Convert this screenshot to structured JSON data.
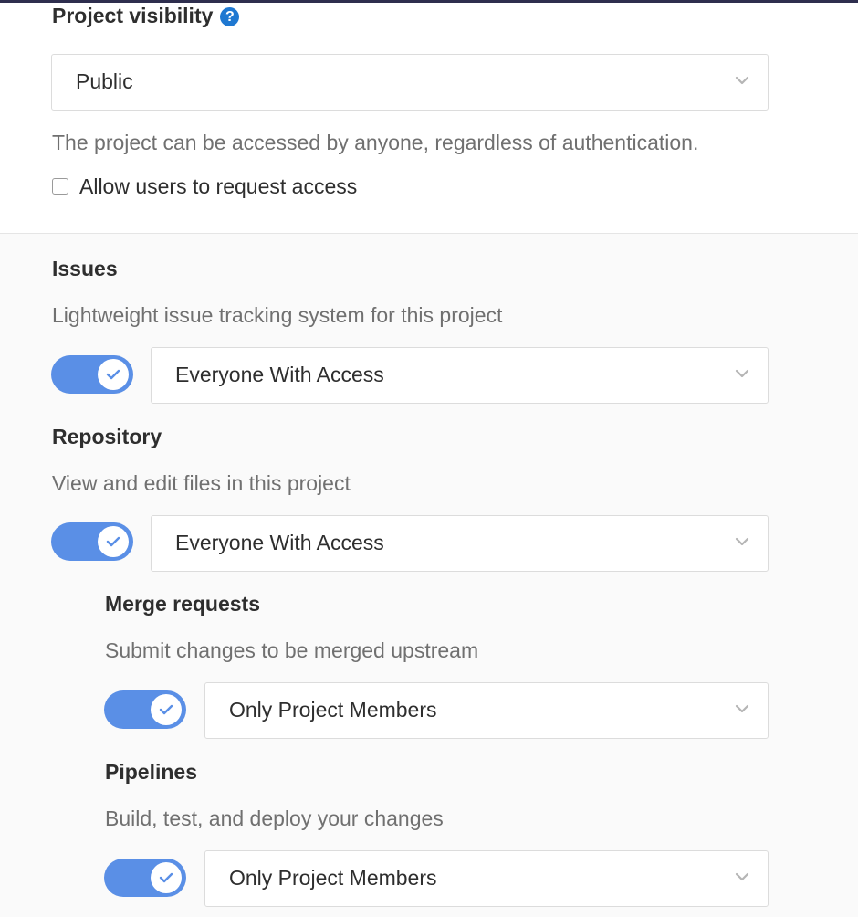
{
  "visibility": {
    "title": "Project visibility",
    "help_icon": "?",
    "select_value": "Public",
    "description": "The project can be accessed by anyone, regardless of authentication.",
    "request_access": {
      "label": "Allow users to request access",
      "checked": false
    }
  },
  "features": {
    "issues": {
      "title": "Issues",
      "description": "Lightweight issue tracking system for this project",
      "enabled": true,
      "access": "Everyone With Access"
    },
    "repository": {
      "title": "Repository",
      "description": "View and edit files in this project",
      "enabled": true,
      "access": "Everyone With Access"
    },
    "merge_requests": {
      "title": "Merge requests",
      "description": "Submit changes to be merged upstream",
      "enabled": true,
      "access": "Only Project Members"
    },
    "pipelines": {
      "title": "Pipelines",
      "description": "Build, test, and deploy your changes",
      "enabled": true,
      "access": "Only Project Members"
    }
  },
  "icons": {
    "help": "question-circle-icon",
    "chevron": "chevron-down-icon",
    "check": "check-icon"
  },
  "colors": {
    "toggle_on": "#5a8fe6",
    "help_icon": "#1f78d1",
    "muted_text": "#707070",
    "panel_bg": "#fafafa"
  }
}
